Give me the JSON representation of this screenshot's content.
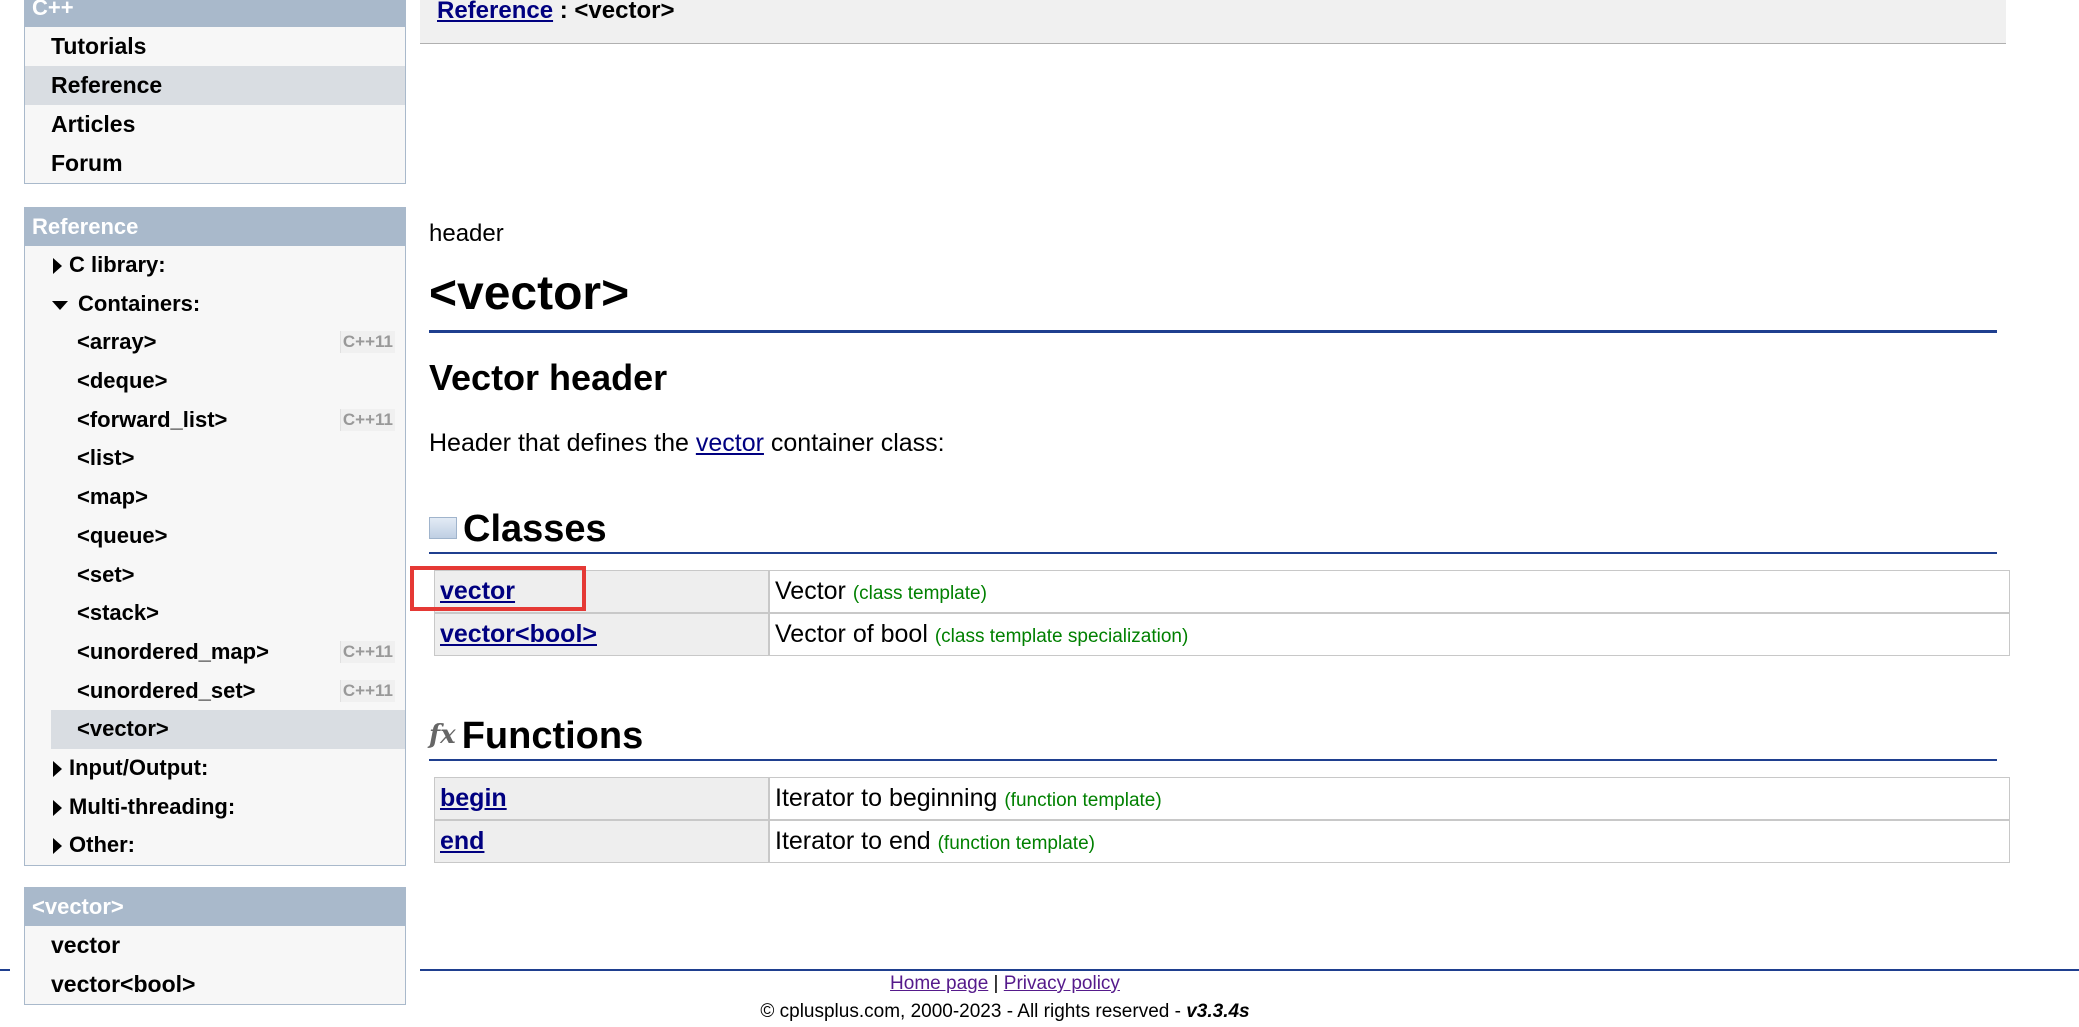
{
  "nav": {
    "title": "C++",
    "items": [
      "Tutorials",
      "Reference",
      "Articles",
      "Forum"
    ]
  },
  "reference_box": {
    "title": "Reference",
    "c_library": "C library:",
    "containers": "Containers:",
    "children": [
      "<array>",
      "<deque>",
      "<forward_list>",
      "<list>",
      "<map>",
      "<queue>",
      "<set>",
      "<stack>",
      "<unordered_map>",
      "<unordered_set>",
      "<vector>"
    ],
    "badge": "C++11",
    "input_output": "Input/Output:",
    "multi_threading": "Multi-threading:",
    "other": "Other:"
  },
  "vector_box": {
    "title": "<vector>",
    "items": [
      "vector",
      "vector<bool>"
    ]
  },
  "breadcrumb": {
    "link": "Reference",
    "sep": " : ",
    "current": "<vector>"
  },
  "page": {
    "kind": "header",
    "title": "<vector>",
    "subtitle": "Vector header",
    "desc_pre": "Header that defines the ",
    "desc_link": "vector",
    "desc_post": " container class:"
  },
  "classes": {
    "heading": "Classes",
    "rows": [
      {
        "name": "vector",
        "desc": "Vector",
        "note": "(class template)"
      },
      {
        "name": "vector<bool>",
        "desc": "Vector of bool",
        "note": "(class template specialization)"
      }
    ]
  },
  "functions": {
    "heading": "Functions",
    "icon_glyph": "fx",
    "rows": [
      {
        "name": "begin",
        "desc": "Iterator to beginning",
        "note": "(function template)"
      },
      {
        "name": "end",
        "desc": "Iterator to end",
        "note": "(function template)"
      }
    ]
  },
  "footer": {
    "home": "Home page",
    "sep": " | ",
    "privacy": "Privacy policy",
    "copyright": "© cplusplus.com, 2000-2023 - All rights reserved - ",
    "version": "v3.3.4s"
  }
}
